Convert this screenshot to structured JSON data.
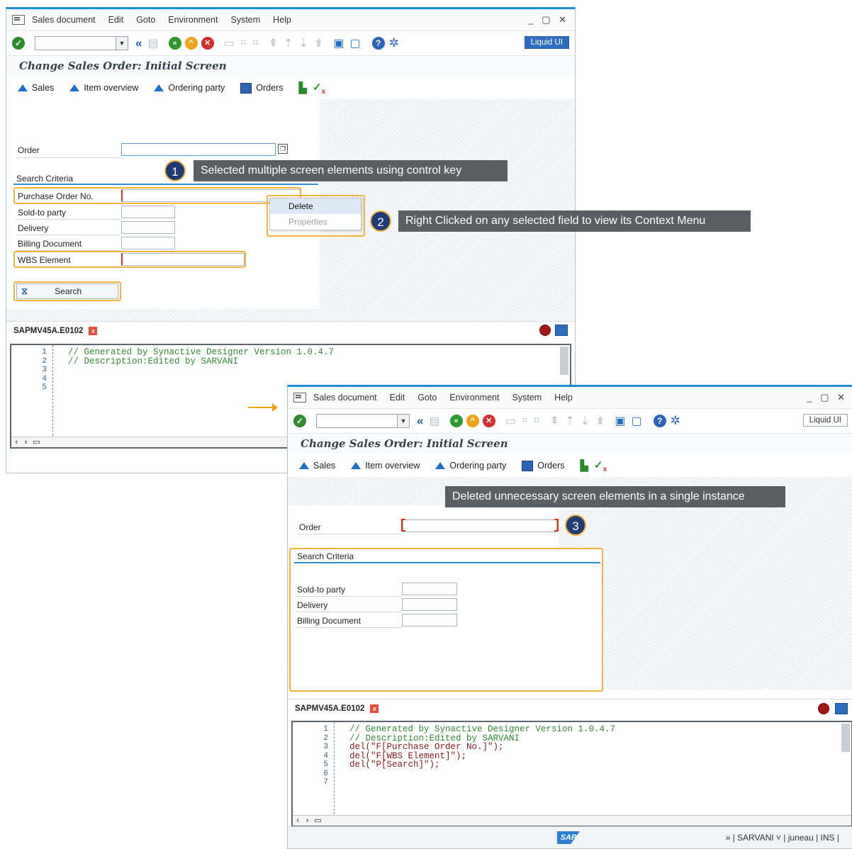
{
  "colors": {
    "accent": "#1a8fd8",
    "highlight": "#f4b33c",
    "callout_bg": "#5a5f64",
    "badge": "#1f3c76"
  },
  "menu": {
    "items": [
      "Sales document",
      "Edit",
      "Goto",
      "Environment",
      "System",
      "Help"
    ]
  },
  "toolbar": {
    "liquid_label": "Liquid UI"
  },
  "screen_title": "Change Sales Order: Initial Screen",
  "app_toolbar": {
    "sales": "Sales",
    "item_overview": "Item overview",
    "ordering_party": "Ordering party",
    "orders": "Orders"
  },
  "form": {
    "order_label": "Order",
    "group_title": "Search Criteria",
    "purchase_order": "Purchase Order No.",
    "sold_to": "Sold-to party",
    "delivery": "Delivery",
    "billing": "Billing Document",
    "wbs": "WBS Element",
    "search_button": "Search"
  },
  "context_menu": {
    "delete": "Delete",
    "properties": "Properties"
  },
  "callouts": {
    "c1": "Selected multiple screen elements using control key",
    "c2": "Right Clicked on any selected field to view its Context Menu",
    "c3": "Deleted unnecessary screen elements in a single instance",
    "n1": "1",
    "n2": "2",
    "n3": "3"
  },
  "script": {
    "name": "SAPMV45A.E0102",
    "code1": [
      "// Generated by Synactive Designer Version 1.0.4.7",
      "// Description:Edited by SARVANI"
    ],
    "code2_comments": [
      "// Generated by Synactive Designer Version 1.0.4.7",
      "// Description:Edited by SARVANI"
    ],
    "code2_lines": [
      "del(\"F[Purchase Order No.]\");",
      "del(\"F[WBS Element]\");",
      "del(\"P[Search]\");"
    ]
  },
  "status": {
    "text": "» | SARVANI ˅ | juneau | INS |",
    "logo": "SAP"
  }
}
